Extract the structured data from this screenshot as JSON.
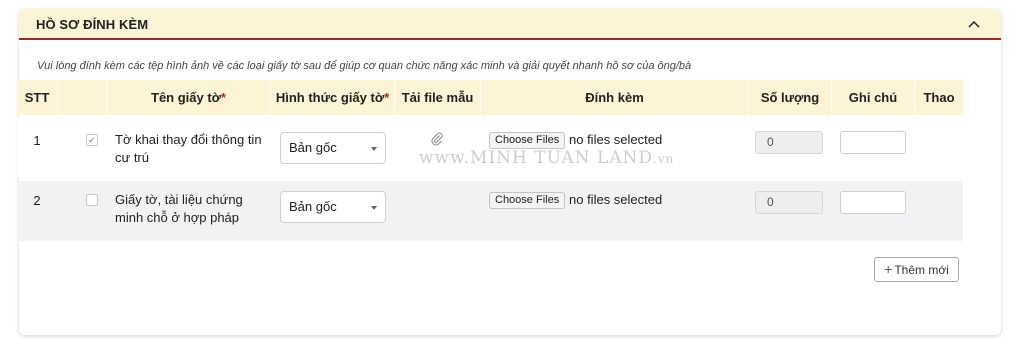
{
  "section": {
    "title": "HỒ SƠ ĐÍNH KÈM",
    "instruction": "Vui lòng đính kèm các tệp hình ảnh về các loại giấy tờ sau để giúp cơ quan chức năng xác minh và giải quyết nhanh hồ sơ của ông/bà",
    "collapse_icon": "chevron-up-icon"
  },
  "table": {
    "columns": {
      "stt": "STT",
      "name": "Tên giấy tờ",
      "form": "Hình thức giấy tờ",
      "template": "Tải file mẫu",
      "attach": "Đính kèm",
      "quantity": "Số lượng",
      "note": "Ghi chú",
      "actions": "Thao tác",
      "required_mark": "*"
    },
    "rows": [
      {
        "stt": "1",
        "checked": true,
        "check_glyph": "✓",
        "name": "Tờ khai thay đổi thông tin cư trú",
        "form": "Bản gốc",
        "template_icon": "paperclip-icon",
        "file_button": "Choose Files",
        "file_status": "no files selected",
        "quantity": "0",
        "note": ""
      },
      {
        "stt": "2",
        "checked": false,
        "check_glyph": "",
        "name": "Giấy tờ, tài liệu chứng minh chỗ ở hợp pháp",
        "form": "Bản gốc",
        "file_button": "Choose Files",
        "file_status": "no files selected",
        "quantity": "0",
        "note": ""
      }
    ]
  },
  "add_button": {
    "plus": "+",
    "label": "Thêm mới"
  },
  "watermark": {
    "main": "www.MINH TUAN LAND",
    "suffix": ".vn"
  },
  "colors": {
    "header_bg": "#fdf3d5",
    "accent_red": "#b0201e",
    "row_alt_bg": "#f2f2f4"
  }
}
